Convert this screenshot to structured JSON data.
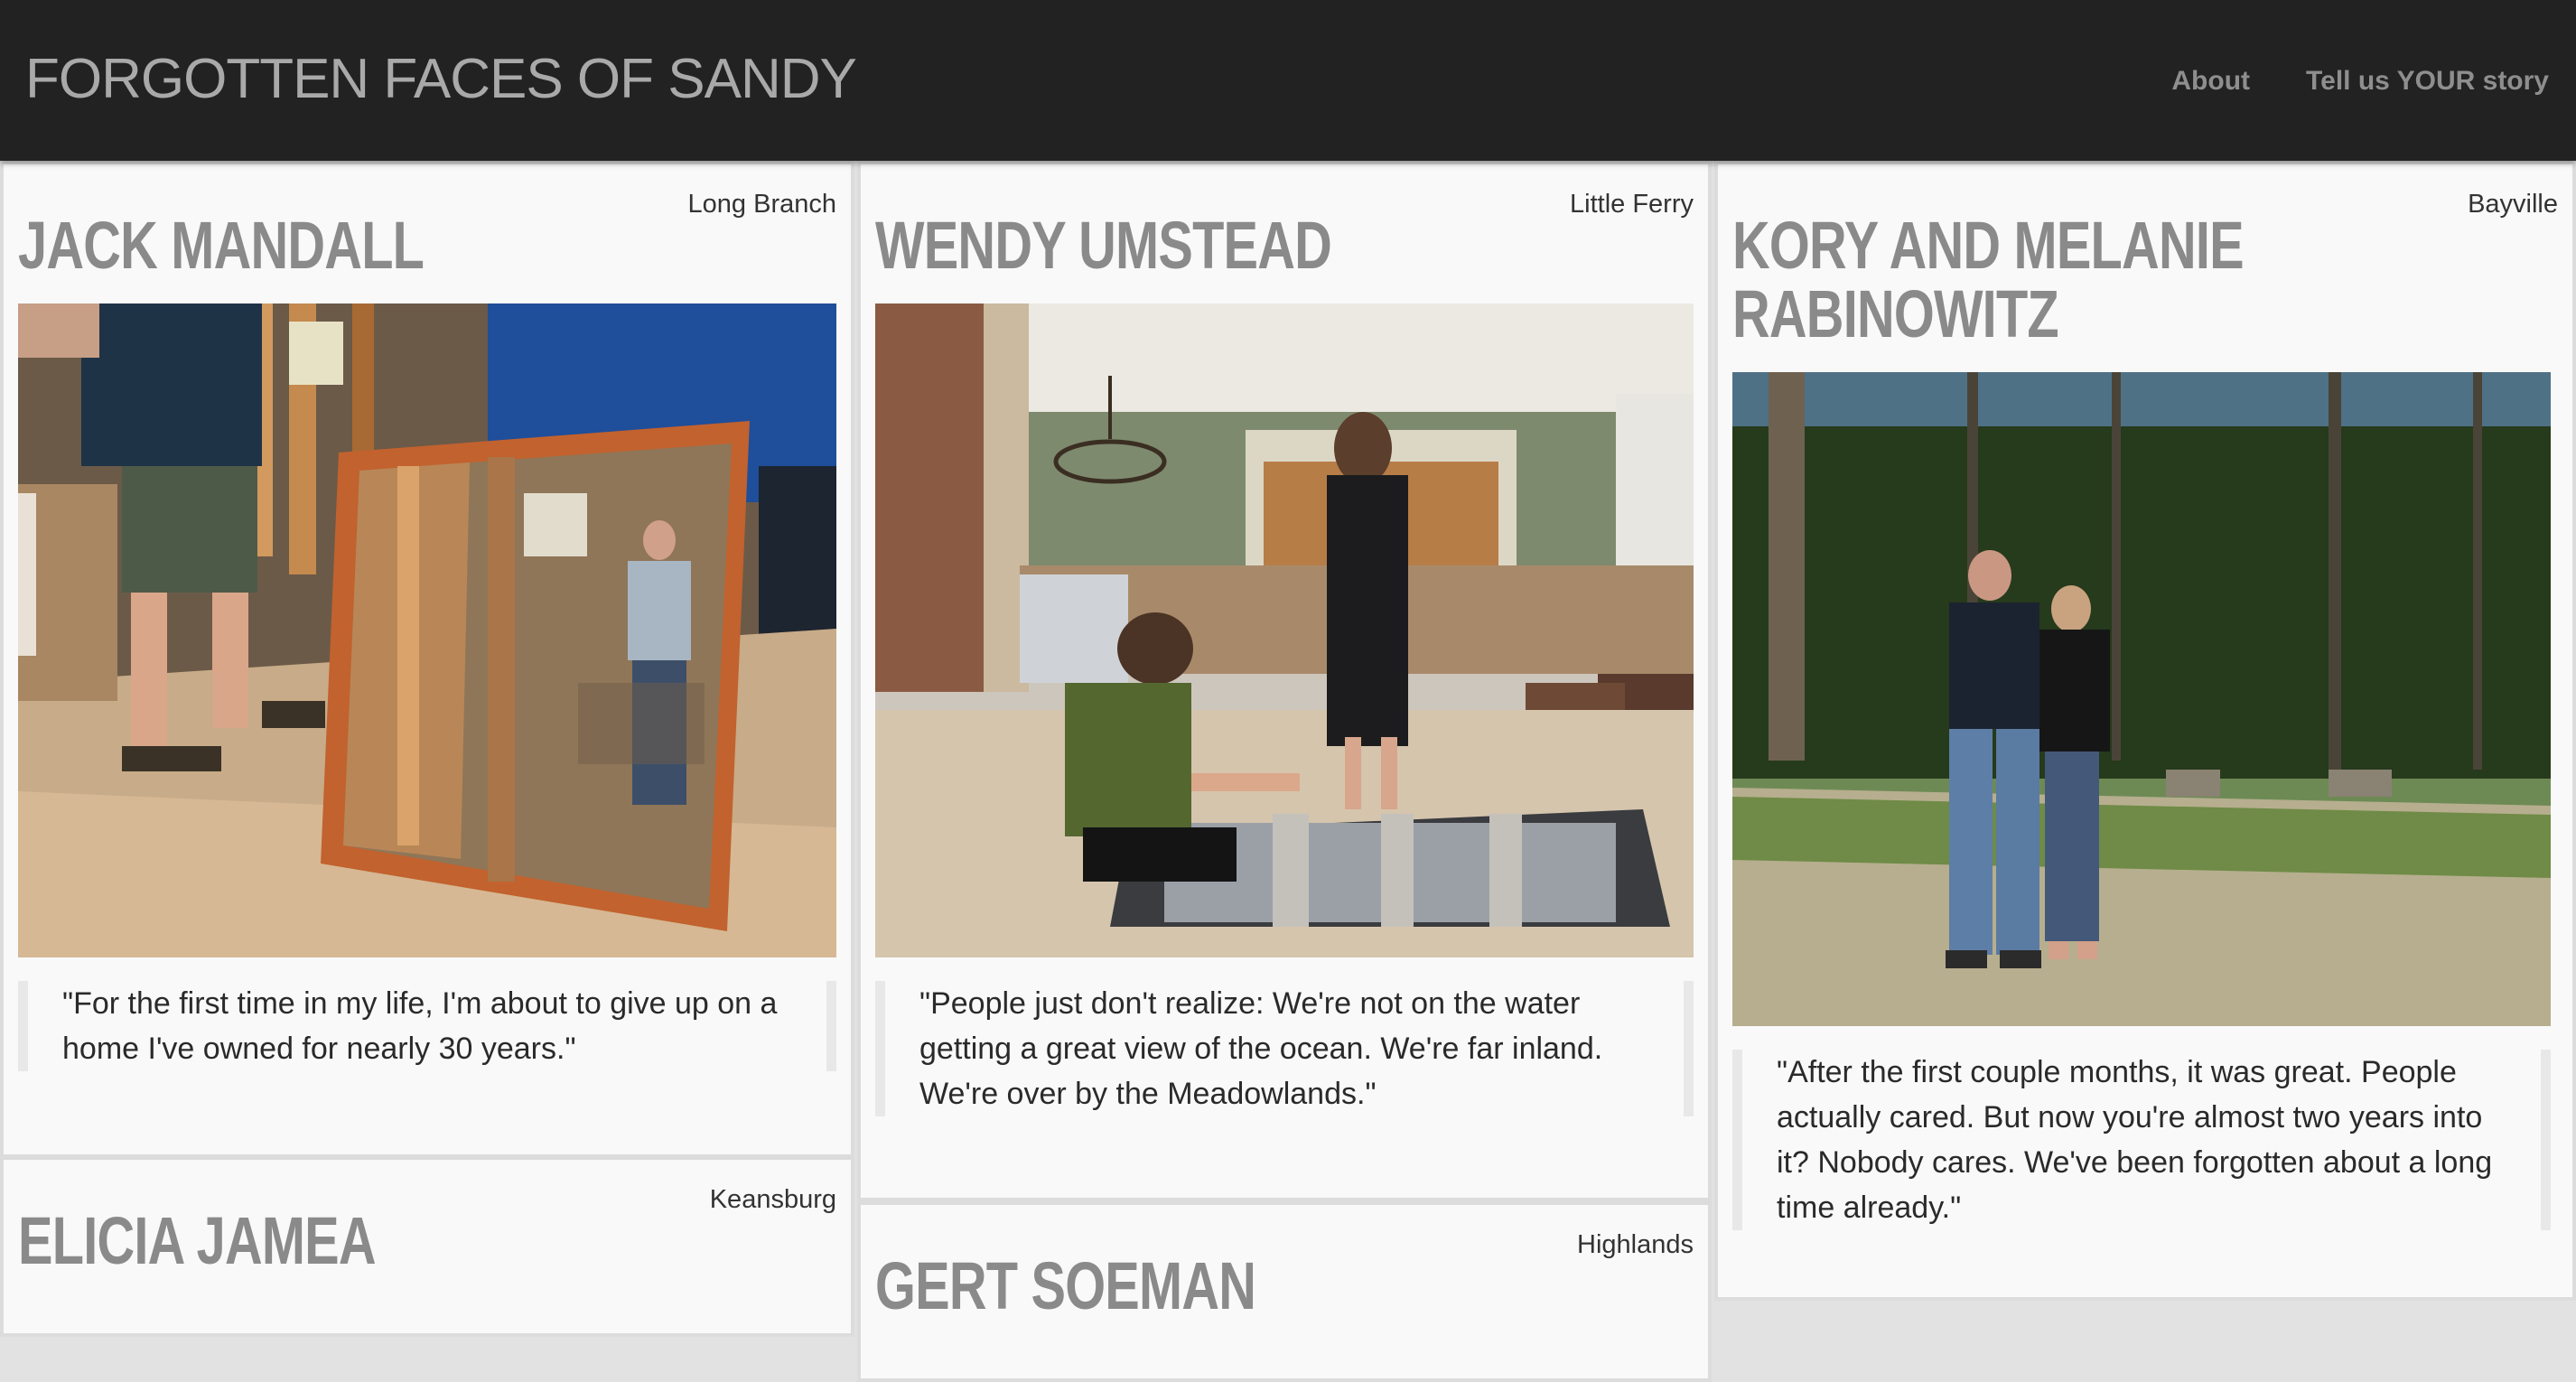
{
  "site": {
    "brand": "FORGOTTEN FACES OF SANDY",
    "nav": [
      {
        "label": "About"
      },
      {
        "label": "Tell us YOUR story"
      }
    ]
  },
  "cards": [
    {
      "name": "JACK MANDALL",
      "location": "Long Branch",
      "quote": "\"For the first time in my life, I'm about to give up on a home I've owned for nearly 30 years.\"",
      "photo_icon": "man-reflected-in-mirror-photo"
    },
    {
      "name": "WENDY UMSTEAD",
      "location": "Little Ferry",
      "quote": "\"People just don't realize: We're not on the water getting a great view of the ocean. We're far inland. We're over by the Meadowlands.\"",
      "photo_icon": "mother-and-son-gutted-floor-photo"
    },
    {
      "name": "KORY AND MELANIE RABINOWITZ",
      "name_line1": "KORY AND MELANIE",
      "name_line2": "RABINOWITZ",
      "location": "Bayville",
      "quote": "\"After the first couple months, it was great. People actually cared. But now you're almost two years into it? Nobody cares. We've been forgotten about a long time already.\"",
      "photo_icon": "couple-in-cleared-lot-photo"
    },
    {
      "name": "ELICIA JAMEA",
      "location": "Keansburg"
    },
    {
      "name": "GERT SOEMAN",
      "location": "Highlands"
    }
  ],
  "colors": {
    "navbar": "#222222",
    "brand_text": "#a9a9a9",
    "nav_link": "#8e8e8e",
    "card_bg": "#f9f9f9",
    "name_text": "#8a8a8a"
  }
}
